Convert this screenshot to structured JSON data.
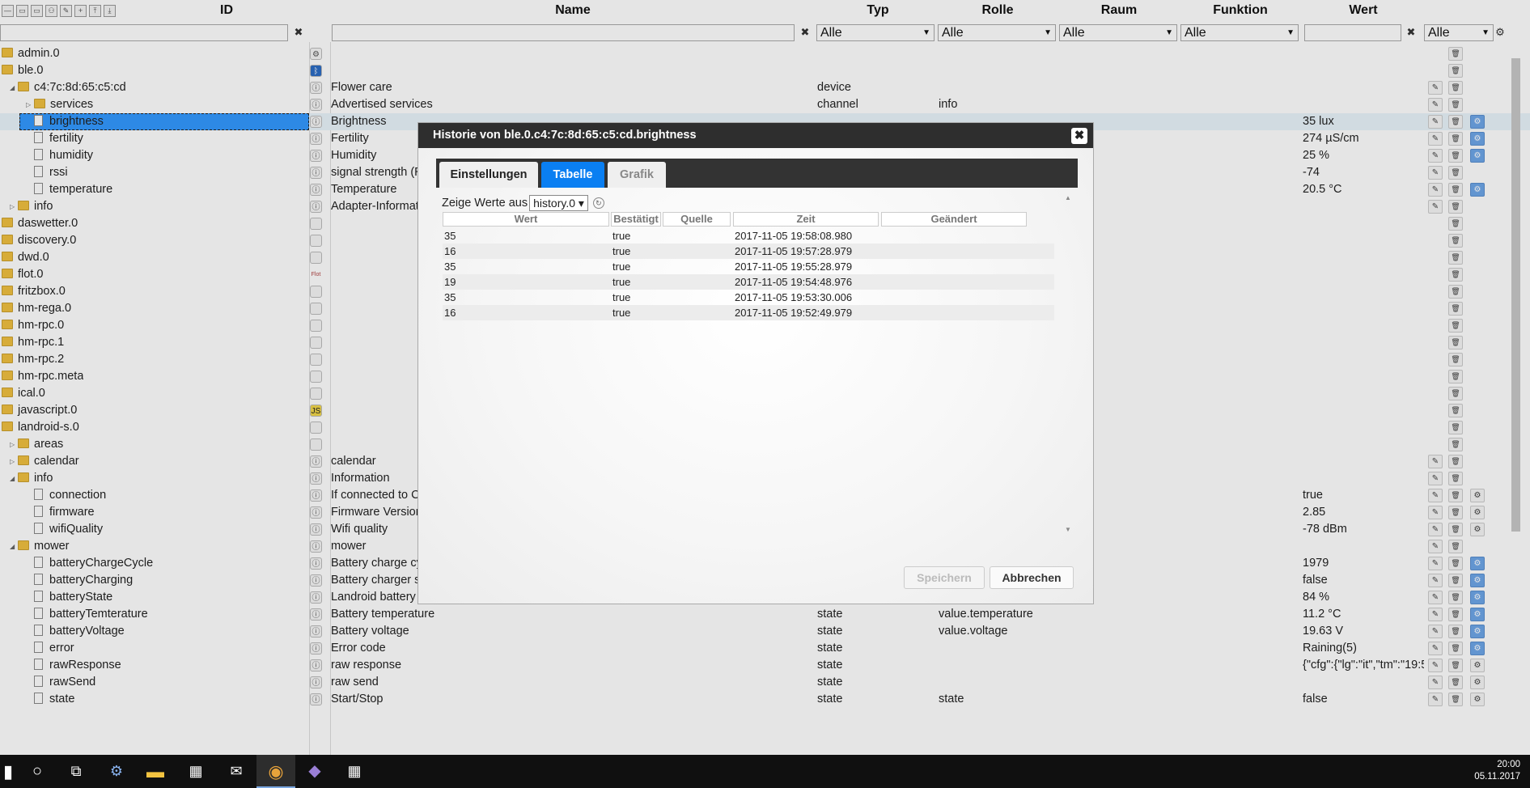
{
  "header": {
    "columns": [
      "ID",
      "Name",
      "Typ",
      "Rolle",
      "Raum",
      "Funktion",
      "Wert"
    ],
    "filters": {
      "typ": "Alle",
      "rolle": "Alle",
      "raum": "Alle",
      "funktion": "Alle",
      "wert_extra": "Alle"
    }
  },
  "tree": [
    {
      "id": "admin.0",
      "icon": "gear-icon",
      "glyph": "⚙"
    },
    {
      "id": "ble.0",
      "icon": "bluetooth-icon",
      "glyph": "ᛒ"
    },
    {
      "id": "c4:7c:8d:65:c5:cd",
      "name": "Flower care",
      "typ": "device"
    },
    {
      "id": "services",
      "name": "Advertised services",
      "typ": "channel",
      "rolle": "info"
    },
    {
      "id": "brightness",
      "name": "Brightness",
      "wert": "35 lux"
    },
    {
      "id": "fertility",
      "name": "Fertility",
      "wert": "274 µS/cm"
    },
    {
      "id": "humidity",
      "name": "Humidity",
      "wert": "25 %"
    },
    {
      "id": "rssi",
      "name": "signal strength (R",
      "wert": "-74"
    },
    {
      "id": "temperature",
      "name": "Temperature",
      "wert": "20.5 °C"
    },
    {
      "id": "info",
      "name": "Adapter-Informat"
    },
    {
      "id": "daswetter.0",
      "icon": "weather-icon"
    },
    {
      "id": "discovery.0",
      "icon": "discovery-icon"
    },
    {
      "id": "dwd.0",
      "icon": "dwd-icon"
    },
    {
      "id": "flot.0",
      "icon": "flot-icon",
      "glyph": "Flot"
    },
    {
      "id": "fritzbox.0",
      "icon": "fritzbox-icon"
    },
    {
      "id": "hm-rega.0",
      "icon": "document-icon"
    },
    {
      "id": "hm-rpc.0",
      "icon": "document-icon"
    },
    {
      "id": "hm-rpc.1",
      "icon": "document-icon"
    },
    {
      "id": "hm-rpc.2",
      "icon": "document-icon"
    },
    {
      "id": "hm-rpc.meta"
    },
    {
      "id": "ical.0",
      "icon": "calendar-icon"
    },
    {
      "id": "javascript.0",
      "icon": "javascript-icon",
      "glyph": "JS"
    },
    {
      "id": "landroid-s.0",
      "icon": "mower-icon"
    },
    {
      "id": "areas"
    },
    {
      "id": "calendar",
      "name": "calendar"
    },
    {
      "id": "info",
      "name": "Information"
    },
    {
      "id": "connection",
      "name": "If connected to C",
      "wert": "true"
    },
    {
      "id": "firmware",
      "name": "Firmware Version",
      "wert": "2.85"
    },
    {
      "id": "wifiQuality",
      "name": "Wifi quality",
      "wert": "-78 dBm"
    },
    {
      "id": "mower",
      "name": "mower"
    },
    {
      "id": "batteryChargeCycle",
      "name": "Battery charge cy",
      "wert": "1979"
    },
    {
      "id": "batteryCharging",
      "name": "Battery charger s",
      "wert": "false"
    },
    {
      "id": "batteryState",
      "name": "Landroid battery",
      "wert": "84 %"
    },
    {
      "id": "batteryTemterature",
      "name": "Battery temperature",
      "typ": "state",
      "rolle": "value.temperature",
      "wert": "11.2 °C"
    },
    {
      "id": "batteryVoltage",
      "name": "Battery voltage",
      "typ": "state",
      "rolle": "value.voltage",
      "wert": "19.63 V"
    },
    {
      "id": "error",
      "name": "Error code",
      "typ": "state",
      "wert": "Raining(5)"
    },
    {
      "id": "rawResponse",
      "name": "raw response",
      "typ": "state",
      "wert": "{\"cfg\":{\"lg\":\"it\",\"tm\":\"19:5"
    },
    {
      "id": "rawSend",
      "name": "raw send",
      "typ": "state"
    },
    {
      "id": "state",
      "name": "Start/Stop",
      "typ": "state",
      "rolle": "state",
      "wert": "false"
    }
  ],
  "dialog": {
    "title": "Historie von ble.0.c4:7c:8d:65:c5:cd.brightness",
    "close": "✖",
    "tabs": [
      "Einstellungen",
      "Tabelle",
      "Grafik"
    ],
    "show_label": "Zeige Werte aus",
    "history_instance": "history.0 ▾",
    "table_headers": [
      "Wert",
      "Bestätigt",
      "Quelle",
      "Zeit",
      "Geändert"
    ],
    "table_rows": [
      {
        "wert": "35",
        "bestaetigt": "true",
        "zeit": "2017-11-05 19:58:08.980"
      },
      {
        "wert": "16",
        "bestaetigt": "true",
        "zeit": "2017-11-05 19:57:28.979"
      },
      {
        "wert": "35",
        "bestaetigt": "true",
        "zeit": "2017-11-05 19:55:28.979"
      },
      {
        "wert": "19",
        "bestaetigt": "true",
        "zeit": "2017-11-05 19:54:48.976"
      },
      {
        "wert": "35",
        "bestaetigt": "true",
        "zeit": "2017-11-05 19:53:30.006"
      },
      {
        "wert": "16",
        "bestaetigt": "true",
        "zeit": "2017-11-05 19:52:49.979"
      }
    ],
    "save_label": "Speichern",
    "cancel_label": "Abbrechen"
  },
  "taskbar": {
    "time": "20:00",
    "date": "05.11.2017",
    "apps": [
      "start-icon",
      "cortana-icon",
      "task-view-icon",
      "network-app-icon",
      "file-explorer-icon",
      "store-icon",
      "mail-icon",
      "chrome-icon",
      "visual-studio-icon",
      "calculator-icon"
    ]
  }
}
